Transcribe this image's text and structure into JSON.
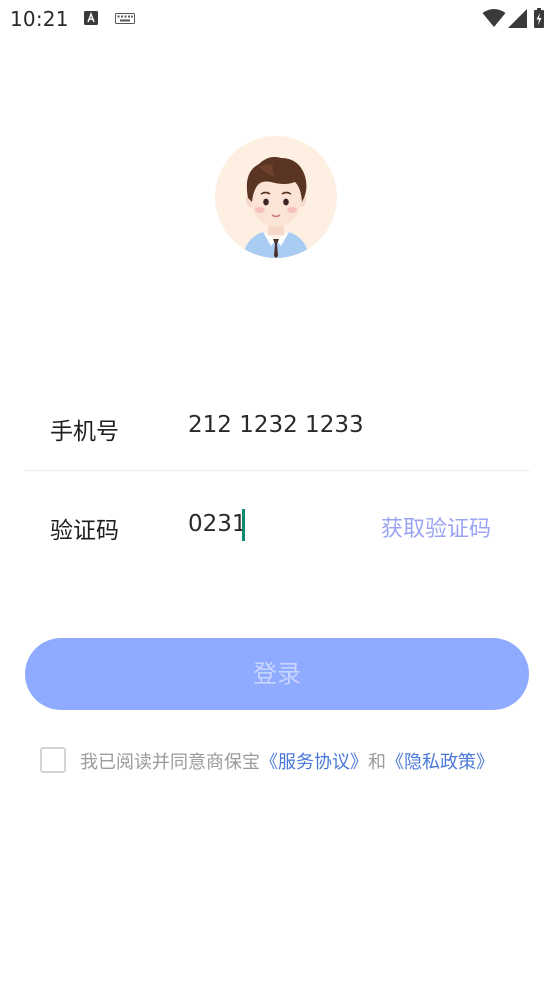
{
  "status_bar": {
    "time": "10:21",
    "icons": [
      "a-icon",
      "keyboard-icon",
      "wifi-icon",
      "cell-signal-icon",
      "battery-charging-icon"
    ]
  },
  "form": {
    "phone_label": "手机号",
    "phone_value": "212 1232 1233",
    "code_label": "验证码",
    "code_value": "0231",
    "get_code_label": "获取验证码"
  },
  "login_button_label": "登录",
  "agreement": {
    "prefix": "我已阅读并同意商保宝",
    "service_link": "《服务协议》",
    "connector": "和",
    "privacy_link": "《隐私政策》"
  },
  "colors": {
    "accent": "#8fabff",
    "link": "#4a78d8",
    "get_code": "#9aa4f2",
    "caret": "#128870"
  }
}
